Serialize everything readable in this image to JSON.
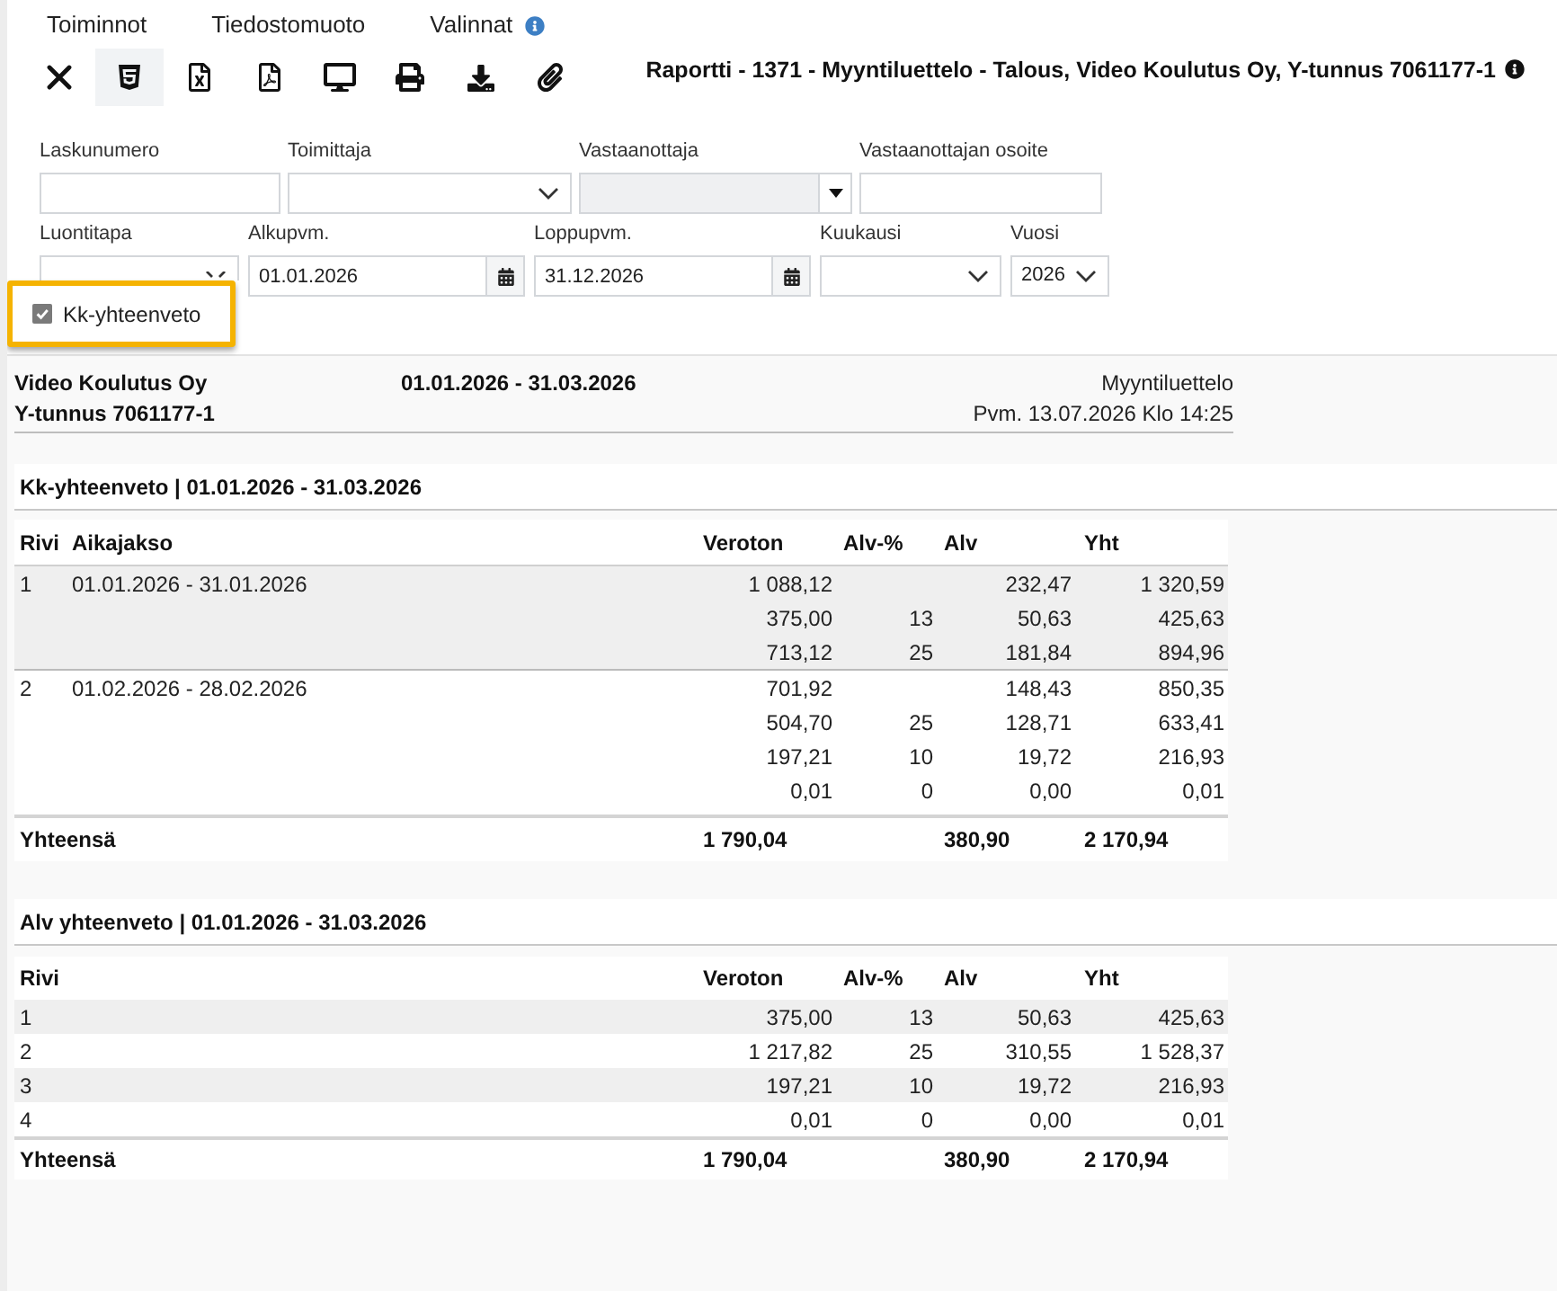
{
  "menu": [
    {
      "label": "Toiminnot",
      "kind": "plain"
    },
    {
      "label": "Tiedostomuoto",
      "kind": "plain"
    },
    {
      "label": "Valinnat",
      "kind": "info"
    }
  ],
  "toolbar": [
    {
      "kind": "close",
      "selected": false
    },
    {
      "kind": "html",
      "selected": true
    },
    {
      "kind": "excel",
      "selected": false
    },
    {
      "kind": "pdf",
      "selected": false
    },
    {
      "kind": "screen",
      "selected": false
    },
    {
      "kind": "print",
      "selected": false
    },
    {
      "kind": "download",
      "selected": false
    },
    {
      "kind": "attach",
      "selected": false
    }
  ],
  "report_title": "Raportti - 1371 - Myyntiluettelo - Talous, Video Koulutus Oy, Y-tunnus 7061177-1",
  "filters": [
    [
      {
        "label": "Laskunumero",
        "kind": "text",
        "disabled": false
      },
      {
        "label": "Toimittaja",
        "kind": "select",
        "disabled": false
      },
      {
        "label": "Vastaanottaja",
        "kind": "combo",
        "disabled": true
      },
      {
        "label": "Vastaanottajan osoite",
        "kind": "text",
        "disabled": false
      }
    ],
    [
      {
        "label": "Luontitapa",
        "kind": "select",
        "disabled": false
      },
      {
        "label": "Alkupvm.",
        "kind": "date",
        "value": "01.01.2026",
        "disabled": false
      },
      {
        "label": "Loppupvm.",
        "kind": "date",
        "value": "31.12.2026",
        "disabled": false
      },
      {
        "label": "Kuukausi",
        "kind": "select",
        "disabled": false
      },
      {
        "label": "Vuosi",
        "kind": "select",
        "value": "2026",
        "disabled": false
      }
    ]
  ],
  "checkbox": {
    "label": "Kk-yhteenveto",
    "checked": true,
    "highlighted": true
  },
  "report_header": {
    "company": "Video Koulutus Oy",
    "business_id": "Y-tunnus 7061177-1",
    "period": "01.01.2026 - 31.03.2026",
    "report_name": "Myyntiluettelo",
    "printed": "Pvm. 13.07.2026 Klo 14:25"
  },
  "monthly_summary": {
    "title": "Kk-yhteenveto | 01.01.2026 - 31.03.2026",
    "columns": [
      "Rivi",
      "Aikajakso",
      "Veroton",
      "Alv-%",
      "Alv",
      "Yht"
    ],
    "groups": [
      {
        "row": "1",
        "period": "01.01.2026 - 31.01.2026",
        "lines": [
          {
            "veroton": "1 088,12",
            "alv": "232,47",
            "yht": "1 320,59"
          },
          {
            "veroton": "375,00",
            "rate": "13",
            "alv": "50,63",
            "yht": "425,63"
          },
          {
            "veroton": "713,12",
            "rate": "25",
            "alv": "181,84",
            "yht": "894,96"
          }
        ]
      },
      {
        "row": "2",
        "period": "01.02.2026 - 28.02.2026",
        "lines": [
          {
            "veroton": "701,92",
            "alv": "148,43",
            "yht": "850,35"
          },
          {
            "veroton": "504,70",
            "rate": "25",
            "alv": "128,71",
            "yht": "633,41"
          },
          {
            "veroton": "197,21",
            "rate": "10",
            "alv": "19,72",
            "yht": "216,93"
          },
          {
            "veroton": "0,01",
            "rate": "0",
            "alv": "0,00",
            "yht": "0,01"
          }
        ]
      }
    ],
    "total": {
      "label": "Yhteensä",
      "veroton": "1 790,04",
      "alv": "380,90",
      "yht": "2 170,94"
    }
  },
  "vat_summary": {
    "title": "Alv yhteenveto | 01.01.2026 - 31.03.2026",
    "columns": [
      "Rivi",
      "Veroton",
      "Alv-%",
      "Alv",
      "Yht"
    ],
    "rows": [
      {
        "row": "1",
        "veroton": "375,00",
        "rate": "13",
        "alv": "50,63",
        "yht": "425,63"
      },
      {
        "row": "2",
        "veroton": "1 217,82",
        "rate": "25",
        "alv": "310,55",
        "yht": "1 528,37"
      },
      {
        "row": "3",
        "veroton": "197,21",
        "rate": "10",
        "alv": "19,72",
        "yht": "216,93"
      },
      {
        "row": "4",
        "veroton": "0,01",
        "rate": "0",
        "alv": "0,00",
        "yht": "0,01"
      }
    ],
    "total": {
      "label": "Yhteensä",
      "veroton": "1 790,04",
      "alv": "380,90",
      "yht": "2 170,94"
    }
  }
}
